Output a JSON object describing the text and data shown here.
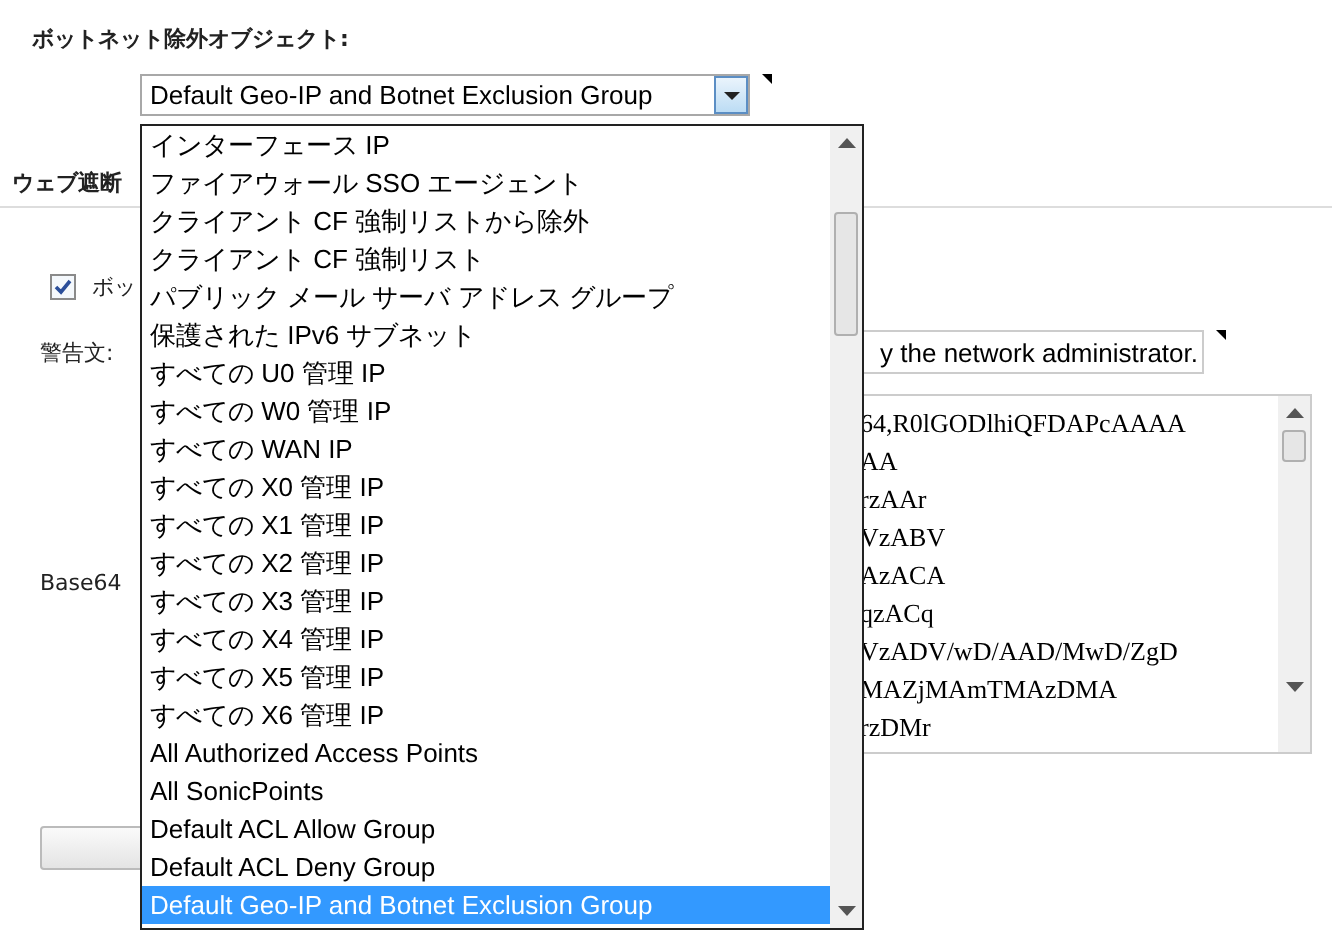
{
  "botnet_label": "ボットネット除外オブジェクト:",
  "select": {
    "value": "Default Geo-IP and Botnet Exclusion Group"
  },
  "section_title": "ウェブ遮断",
  "checkbox": {
    "label": "ボッ",
    "checked": true
  },
  "warning": {
    "label": "警告文:",
    "value": "y the network administrator."
  },
  "base64_label": "Base64",
  "base64_lines": [
    "64,R0lGODlhiQFDAPcAAAA",
    "AA",
    "rzAAr",
    "VzABV",
    "AzACA",
    "qzACq",
    "VzADV/wD/AAD/MwD/ZgD",
    "MAZjMAmTMAzDMA",
    "rzDMr"
  ],
  "dropdown_options": [
    {
      "label": "インターフェース IP",
      "selected": false
    },
    {
      "label": "ファイアウォール SSO エージェント",
      "selected": false
    },
    {
      "label": "クライアント CF 強制リストから除外",
      "selected": false
    },
    {
      "label": "クライアント CF 強制リスト",
      "selected": false
    },
    {
      "label": "パブリック メール サーバ アドレス グループ",
      "selected": false
    },
    {
      "label": "保護された IPv6 サブネット",
      "selected": false
    },
    {
      "label": "すべての U0 管理 IP",
      "selected": false
    },
    {
      "label": "すべての W0 管理 IP",
      "selected": false
    },
    {
      "label": "すべての WAN IP",
      "selected": false
    },
    {
      "label": "すべての X0 管理 IP",
      "selected": false
    },
    {
      "label": "すべての X1 管理 IP",
      "selected": false
    },
    {
      "label": "すべての X2 管理 IP",
      "selected": false
    },
    {
      "label": "すべての X3 管理 IP",
      "selected": false
    },
    {
      "label": "すべての X4 管理 IP",
      "selected": false
    },
    {
      "label": "すべての X5 管理 IP",
      "selected": false
    },
    {
      "label": "すべての X6 管理 IP",
      "selected": false
    },
    {
      "label": "All Authorized Access Points",
      "selected": false
    },
    {
      "label": "All SonicPoints",
      "selected": false
    },
    {
      "label": "Default ACL Allow Group",
      "selected": false
    },
    {
      "label": "Default ACL Deny Group",
      "selected": false
    },
    {
      "label": "Default Geo-IP and Botnet Exclusion Group",
      "selected": true
    }
  ]
}
